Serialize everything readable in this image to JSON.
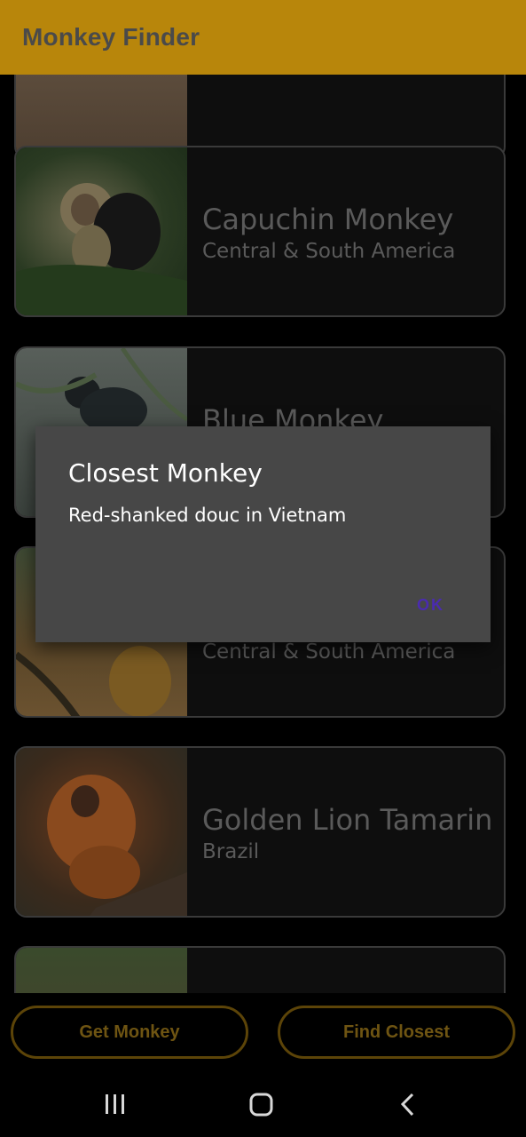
{
  "app_bar": {
    "title": "Monkey Finder"
  },
  "monkeys": [
    {
      "name": "",
      "location": "",
      "thumb": "bald-uakari"
    },
    {
      "name": "Capuchin Monkey",
      "location": "Central & South America",
      "thumb": "capuchin"
    },
    {
      "name": "Blue Monkey",
      "location": "",
      "thumb": "blue-monkey"
    },
    {
      "name": "",
      "location": "Central & South America",
      "thumb": "squirrel-monkey"
    },
    {
      "name": "Golden Lion Tamarin",
      "location": "Brazil",
      "thumb": "golden-lion-tamarin"
    },
    {
      "name": "",
      "location": "",
      "thumb": "mandrill"
    }
  ],
  "buttons": {
    "get_monkey": "Get Monkey",
    "find_closest": "Find Closest"
  },
  "dialog": {
    "title": "Closest Monkey",
    "message": "Red-shanked douc in Vietnam",
    "ok_label": "OK"
  },
  "colors": {
    "accent": "#b8860b",
    "dialog_bg": "#474747",
    "dialog_button": "#4a2bb0"
  }
}
